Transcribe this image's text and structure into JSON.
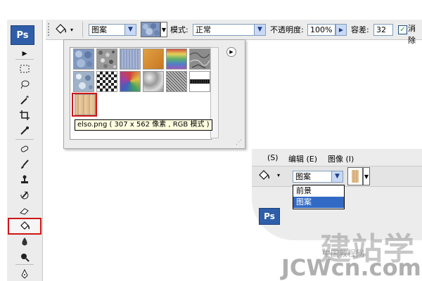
{
  "app": {
    "logo_text": "Ps"
  },
  "toolbar": {
    "tools": [
      {
        "name": "move-tool",
        "glyph": "▸✛"
      },
      {
        "name": "marquee-tool",
        "glyph": "⬚"
      },
      {
        "name": "lasso-tool",
        "glyph": "ℓ"
      },
      {
        "name": "magic-wand-tool",
        "glyph": "✸"
      },
      {
        "name": "crop-tool",
        "glyph": "⌗"
      },
      {
        "name": "slice-tool",
        "glyph": "⁄"
      },
      {
        "name": "healing-tool",
        "glyph": "✚"
      },
      {
        "name": "brush-tool",
        "glyph": "✎"
      },
      {
        "name": "stamp-tool",
        "glyph": "♙"
      },
      {
        "name": "history-brush-tool",
        "glyph": "↺"
      },
      {
        "name": "eraser-tool",
        "glyph": "▱"
      },
      {
        "name": "paint-bucket-tool",
        "glyph": "⛟"
      },
      {
        "name": "blur-tool",
        "glyph": "◆"
      },
      {
        "name": "dodge-tool",
        "glyph": "●"
      },
      {
        "name": "pen-tool",
        "glyph": "✒"
      }
    ]
  },
  "options_bar": {
    "fill_source": "图案",
    "mode_label": "模式:",
    "mode_value": "正常",
    "opacity_label": "不透明度:",
    "opacity_value": "100%",
    "tolerance_label": "容差:",
    "tolerance_value": "32",
    "antialias_label": "消除",
    "antialias_checked": true
  },
  "pattern_picker": {
    "tooltip": "elso.png ( 307 x 562 像素 , RGB 模式 )",
    "patterns": [
      {
        "name": "bubbles",
        "color": "#7f98c0"
      },
      {
        "name": "gravel",
        "color": "#9a9a9a"
      },
      {
        "name": "blue-fabric",
        "color": "#8e9ec4"
      },
      {
        "name": "wood-orange",
        "color": "#d38a2e"
      },
      {
        "name": "rainbow",
        "color": "#8fb96a"
      },
      {
        "name": "rock",
        "color": "#8c8c8c"
      },
      {
        "name": "molecular",
        "color": "#9fb2c8"
      },
      {
        "name": "checker",
        "color": "#555555"
      },
      {
        "name": "multicolor",
        "color": "#9c6aa0"
      },
      {
        "name": "clouds",
        "color": "#b8b8b8"
      },
      {
        "name": "noise",
        "color": "#a0a0a0"
      },
      {
        "name": "stripes",
        "color": "#777777"
      },
      {
        "name": "grey-texture",
        "color": "#b0b0b0"
      },
      {
        "name": "elso-wood",
        "color": "#d9b487"
      }
    ]
  },
  "inset": {
    "menu_items": [
      "(S)",
      "编辑 (E)",
      "图像 (I)"
    ],
    "fill_source": "图案",
    "dropdown_options": [
      "前景",
      "图案"
    ],
    "selected_option": "图案",
    "logo_text": "Ps"
  },
  "watermark": {
    "big": "建站学",
    "site_cn": "中国教程网",
    "domain": "JCWcn.com"
  },
  "colors": {
    "highlight_red": "#d01616",
    "selected_blue": "#316ac5",
    "panel_grey": "#ececec"
  }
}
